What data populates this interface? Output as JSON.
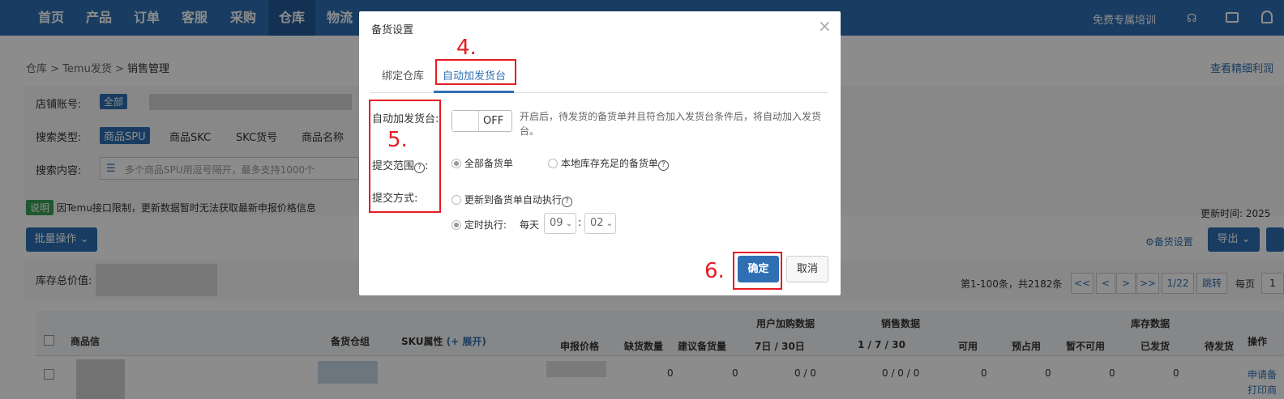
{
  "nav": {
    "items": [
      "首页",
      "产品",
      "订单",
      "客服",
      "采购",
      "仓库",
      "物流"
    ],
    "training": "免费专属培训"
  },
  "breadcrumb": {
    "root": "仓库",
    "sep1": ">",
    "mid": "Temu发货",
    "sep2": ">",
    "current": "销售管理",
    "right_link": "查看精细利润"
  },
  "filters": {
    "shop_label": "店铺账号:",
    "shop_all": "全部",
    "type_label": "搜索类型:",
    "types": [
      "商品SPU",
      "商品SKC",
      "SKC货号",
      "商品名称"
    ],
    "content_label": "搜索内容:",
    "content_placeholder": "多个商品SPU用逗号隔开，最多支持1000个"
  },
  "notice": {
    "tag": "说明",
    "text": "因Temu接口限制，更新数据暂时无法获取最新申报价格信息"
  },
  "toolbar": {
    "batch": "批量操作",
    "update_time": "更新时间: 2025",
    "stock_setting": "备货设置",
    "export": "导出"
  },
  "summary": {
    "stock_value_label": "库存总价值:"
  },
  "pagination": {
    "info": "第1-100条，共2182条",
    "first": "<<",
    "prev": "<",
    "next": ">",
    "last": ">>",
    "page": "1/22",
    "jump": "跳转",
    "per_page": "每页",
    "per_page_val": "1"
  },
  "table": {
    "headers": {
      "product": "商品信",
      "group": "备货仓组",
      "sku": "SKU属性",
      "expand": "(+ 展开)",
      "price": "申报价格",
      "short": "缺货数量",
      "suggest": "建议备货量",
      "user_buy": "用户加购数据",
      "d7": "7日",
      "d30": "/ 30日",
      "sales": "销售数据",
      "s1": "1",
      "s7": "/ 7",
      "s30": "/ 30",
      "stock": "库存数据",
      "avail": "可用",
      "pre": "预占用",
      "unavail": "暂不可用",
      "shipped": "已发货",
      "pending": "待发货",
      "action": "操作"
    },
    "row": {
      "short": "0",
      "suggest": "0",
      "buy": "0 / 0",
      "sales": "0 / 0 / 0",
      "avail": "0",
      "pre": "0",
      "unavail": "0",
      "shipped": "0",
      "apply": "申请备",
      "print": "打印商"
    }
  },
  "modal": {
    "title": "备货设置",
    "close": "×",
    "tabs": [
      "绑定仓库",
      "自动加发货台"
    ],
    "auto_label": "自动加发货台:",
    "toggle": "OFF",
    "auto_desc": "开启后，待发货的备货单并且符合加入发货台条件后，将自动加入发货台。",
    "scope_label": "提交范围",
    "scope_opts": [
      "全部备货单",
      "本地库存充足的备货单"
    ],
    "method_label": "提交方式:",
    "method_opt1": "更新到备货单自动执行",
    "method_opt2": "定时执行:",
    "daily": "每天",
    "hour": "09",
    "minute": "02",
    "confirm": "确定",
    "cancel": "取消"
  },
  "annotations": {
    "n4": "4.",
    "n5": "5.",
    "n6": "6."
  },
  "colors": {
    "nav": "#2f6fb3",
    "accent": "#1e88e5",
    "annotation": "#e51c23"
  }
}
